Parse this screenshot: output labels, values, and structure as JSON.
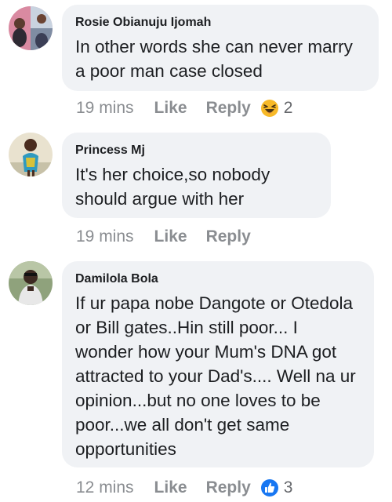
{
  "comments": [
    {
      "author": "Rosie Obianuju Ijomah",
      "text": "In other words she can never marry a poor man case closed",
      "time": "19 mins",
      "like_label": "Like",
      "reply_label": "Reply",
      "reaction_icon": "laughing-emoji-icon",
      "reaction_count": "2"
    },
    {
      "author": "Princess Mj",
      "text": "It's her choice,so nobody should argue with her",
      "time": "19 mins",
      "like_label": "Like",
      "reply_label": "Reply"
    },
    {
      "author": "Damilola Bola",
      "text": "If ur papa nobe Dangote or Otedola or Bill gates..Hin still poor... I wonder how your Mum's DNA got attracted to your Dad's.... Well na ur opinion...but no one loves to be poor...we all don't get same opportunities",
      "time": "12 mins",
      "like_label": "Like",
      "reply_label": "Reply",
      "reaction_icon": "thumbs-up-icon",
      "reaction_count": "3"
    }
  ],
  "colors": {
    "bubble": "#f0f2f5",
    "meta_text": "#8a8d91",
    "like_blue": "#1877f2",
    "haha_yellow": "#f7b928"
  }
}
